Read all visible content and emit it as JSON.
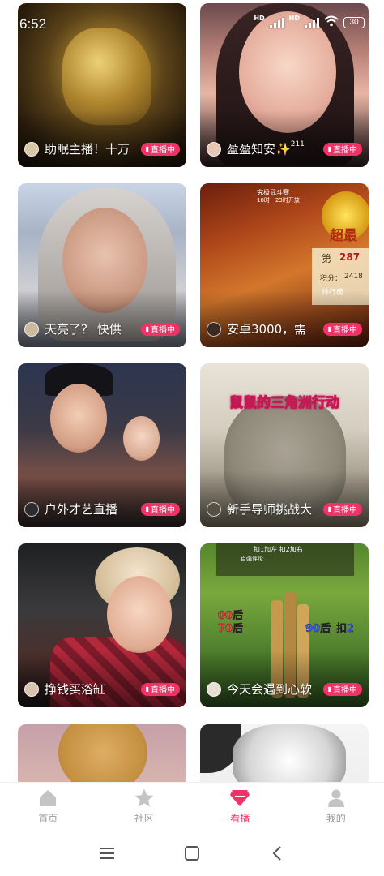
{
  "status_bar": {
    "time": "6:52",
    "network_labels": [
      "HD",
      "HD"
    ],
    "battery": "30"
  },
  "live_badge": "直播中",
  "cards": [
    {
      "title": "助眠主播！十万",
      "title_sup": "",
      "badge": "直播中"
    },
    {
      "title": "盈盈知安✨",
      "title_sup": "211",
      "badge": "直播中"
    },
    {
      "title": "天亮了？ 快供",
      "title_sup": "",
      "badge": "直播中"
    },
    {
      "title": "安卓3000，需",
      "title_sup": "",
      "badge": "直播中",
      "overlay_text": [
        "究极武斗赛",
        "18时－23时开放",
        "超最",
        "第",
        "287",
        "积分：",
        "2418",
        "排行榜"
      ]
    },
    {
      "title": "户外才艺直播",
      "title_sup": "",
      "badge": "直播中"
    },
    {
      "title": "新手导师挑战大",
      "title_sup": "",
      "badge": "直播中",
      "overlay_text": [
        "鼠鼠的三角洲行动"
      ]
    },
    {
      "title": "挣钱买浴缸",
      "title_sup": "",
      "badge": "直播中"
    },
    {
      "title": "今天会遇到心软",
      "title_sup": "",
      "badge": "直播中",
      "overlay_text": [
        "扣1加左 扣2加右",
        "百强评论",
        "00后",
        "70后",
        "90后",
        "扣2"
      ]
    },
    {
      "title": "",
      "title_sup": "",
      "badge": ""
    },
    {
      "title": "",
      "title_sup": "",
      "badge": ""
    }
  ],
  "tabs": [
    {
      "label": "首页",
      "icon": "home-icon",
      "active": false
    },
    {
      "label": "社区",
      "icon": "star-icon",
      "active": false
    },
    {
      "label": "看播",
      "icon": "live-gem-icon",
      "active": true
    },
    {
      "label": "我的",
      "icon": "profile-icon",
      "active": false
    }
  ],
  "colors": {
    "accent": "#f03366",
    "tab_inactive": "#9a9a9a",
    "background": "#ffffff"
  },
  "system_nav": [
    "menu-icon",
    "home-square-icon",
    "back-icon"
  ]
}
